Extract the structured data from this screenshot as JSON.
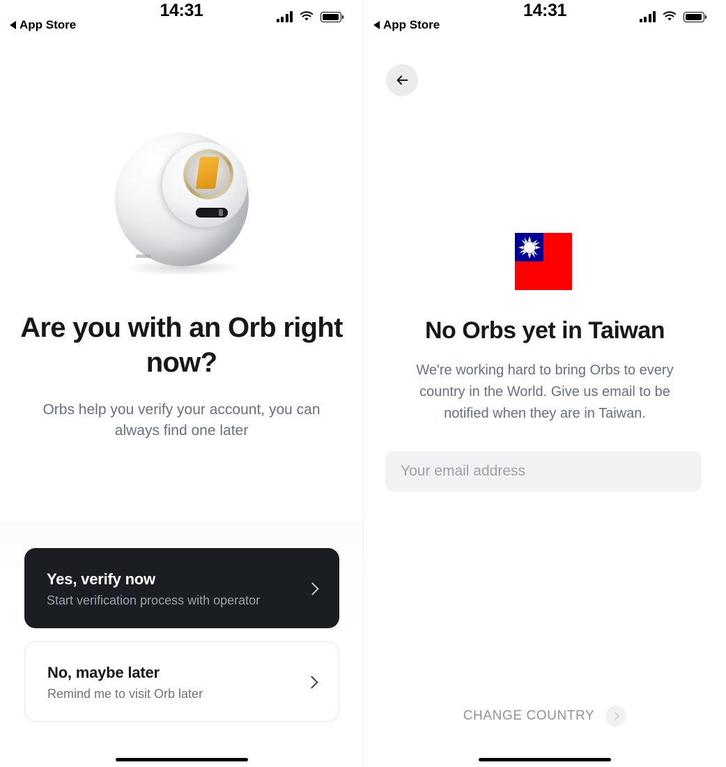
{
  "status_bar": {
    "time": "14:31",
    "back_app_label": "App Store",
    "icons": [
      "signal-icon",
      "wifi-icon",
      "battery-icon"
    ]
  },
  "colors": {
    "accent_dark": "#1a1e23",
    "text_primary": "#16181a",
    "text_muted": "#657084",
    "field_bg": "#f1f2f4",
    "flag_red": "#fe0000",
    "flag_blue": "#000095"
  },
  "screen_left": {
    "hero_icon": "orb-device-image",
    "headline": "Are you with an Orb right now?",
    "subline": "Orbs help you verify your account, you can always find one later",
    "actions": [
      {
        "name": "verify-now",
        "title": "Yes, verify now",
        "subtitle": "Start verification process with operator",
        "style": "primary",
        "chevron": "chevron-right-icon"
      },
      {
        "name": "maybe-later",
        "title": "No, maybe later",
        "subtitle": "Remind me to visit Orb later",
        "style": "secondary",
        "chevron": "chevron-right-icon"
      }
    ]
  },
  "screen_right": {
    "back_button_icon": "arrow-left-icon",
    "flag": "taiwan-flag",
    "headline": "No Orbs yet in Taiwan",
    "subline": "We're working hard to bring Orbs to every country in the World. Give us email to be notified when they are in Taiwan.",
    "email_input": {
      "value": "",
      "placeholder": "Your email address"
    },
    "change_country": {
      "label": "CHANGE COUNTRY",
      "chevron": "chevron-right-icon"
    }
  }
}
